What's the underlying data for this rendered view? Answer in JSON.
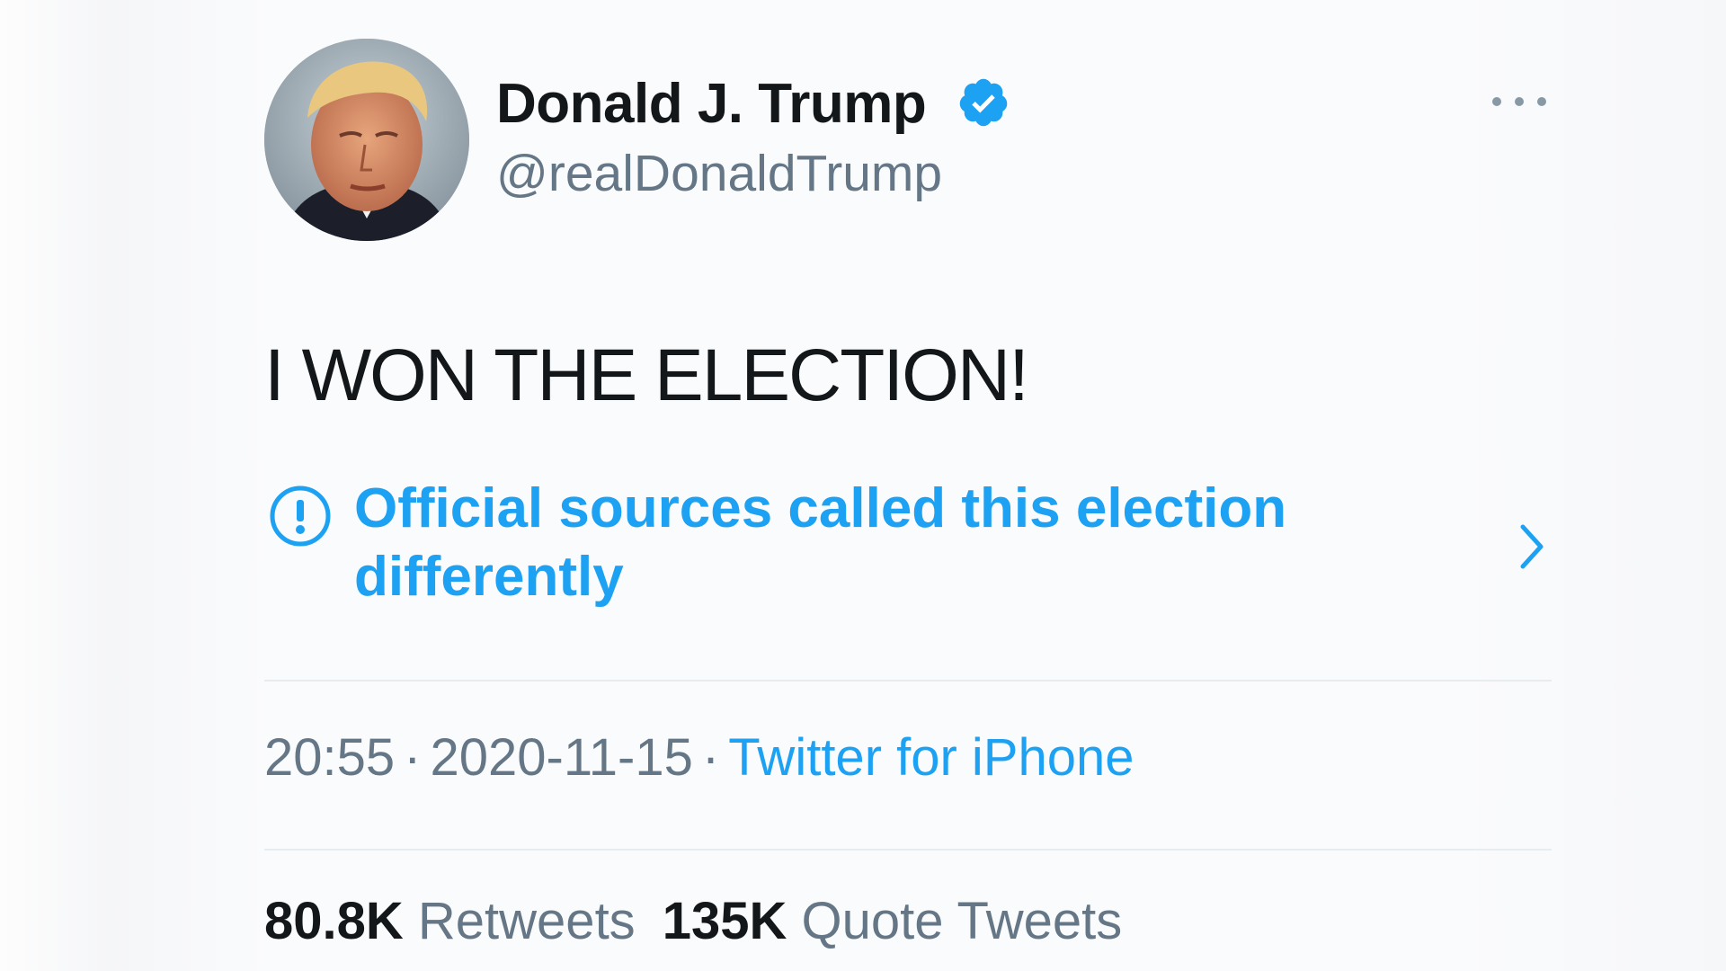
{
  "author": {
    "display_name": "Donald J. Trump",
    "handle": "@realDonaldTrump",
    "verified": true,
    "avatar_icon": "profile-photo"
  },
  "tweet": {
    "text": "I WON THE ELECTION!"
  },
  "notice": {
    "text": "Official sources called this election differently",
    "icon": "exclamation-circle-icon",
    "chevron": "chevron-right-icon"
  },
  "meta": {
    "time": "20:55",
    "date": "2020-11-15",
    "separator": "·",
    "source": "Twitter for iPhone"
  },
  "stats": {
    "retweets_count": "80.8K",
    "retweets_label": "Retweets",
    "quote_tweets_count": "135K",
    "quote_tweets_label": "Quote Tweets"
  },
  "colors": {
    "accent": "#1da1f2",
    "text_primary": "#14171a",
    "text_secondary": "#657786",
    "divider": "#e6ecf0"
  }
}
